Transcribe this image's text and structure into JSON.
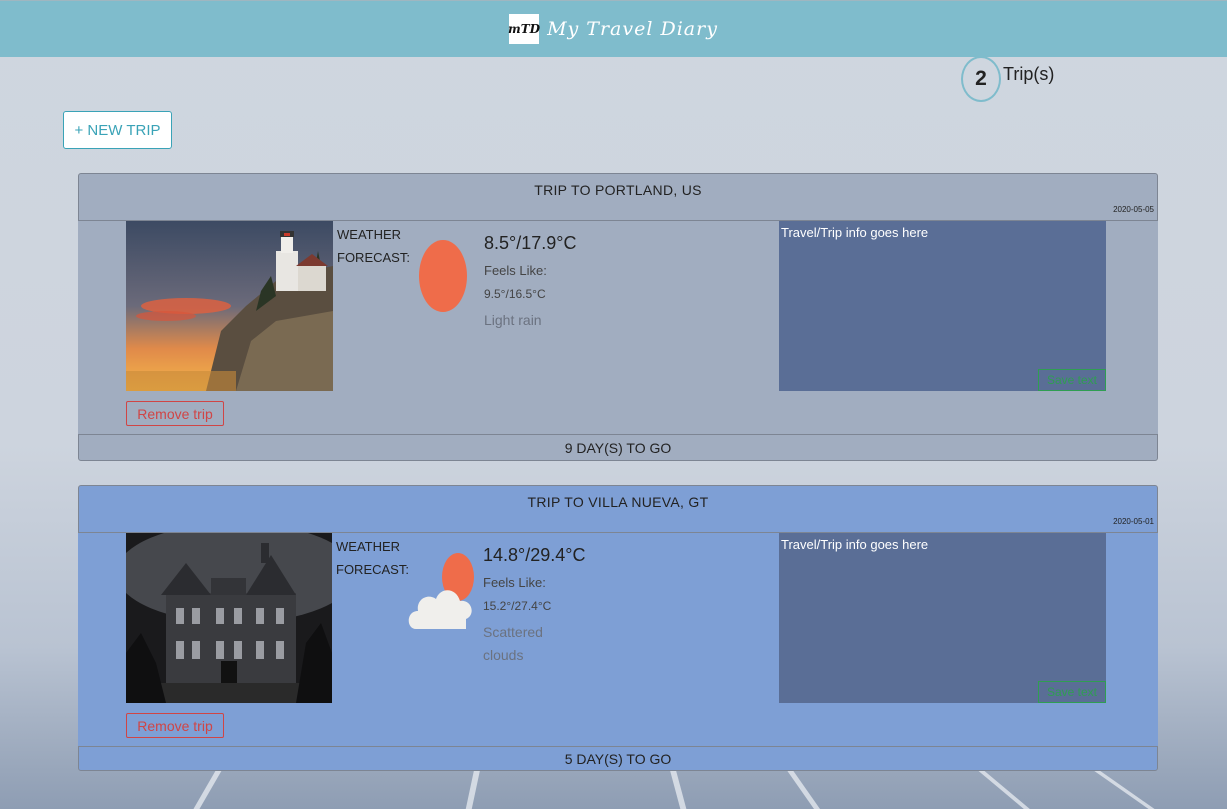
{
  "header": {
    "logo_text": "mTD",
    "title": "My Travel Diary"
  },
  "trip_counter": {
    "count": "2",
    "label": "Trip(s)"
  },
  "new_trip_button": "+ NEW TRIP",
  "trips": [
    {
      "title": "TRIP TO PORTLAND, US",
      "date": "2020-05-05",
      "weather_label": "WEATHER FORECAST:",
      "weather_icon": "sun-icon",
      "temp": "8.5°/17.9°C",
      "feels_label": "Feels Like:",
      "feels_value": "9.5°/16.5°C",
      "description": "Light rain",
      "notes": "Travel/Trip info goes here",
      "save_label": "Save text",
      "remove_label": "Remove trip",
      "countdown": "9 DAY(S) TO GO"
    },
    {
      "title": "TRIP TO VILLA NUEVA, GT",
      "date": "2020-05-01",
      "weather_label": "WEATHER FORECAST:",
      "weather_icon": "cloud-sun-icon",
      "temp": "14.8°/29.4°C",
      "feels_label": "Feels Like:",
      "feels_value": "15.2°/27.4°C",
      "description": "Scattered clouds",
      "notes": "Travel/Trip info goes here",
      "save_label": "Save text",
      "remove_label": "Remove trip",
      "countdown": "5 DAY(S) TO GO"
    }
  ],
  "colors": {
    "header": "#7fbccc",
    "accent": "#3aa3b7",
    "card1": "#a1adc0",
    "card2": "#7e9fd5",
    "notes_bg": "#5a6e96",
    "remove": "#d04545",
    "save": "#2f9e52",
    "sun": "#ef6c4a"
  }
}
